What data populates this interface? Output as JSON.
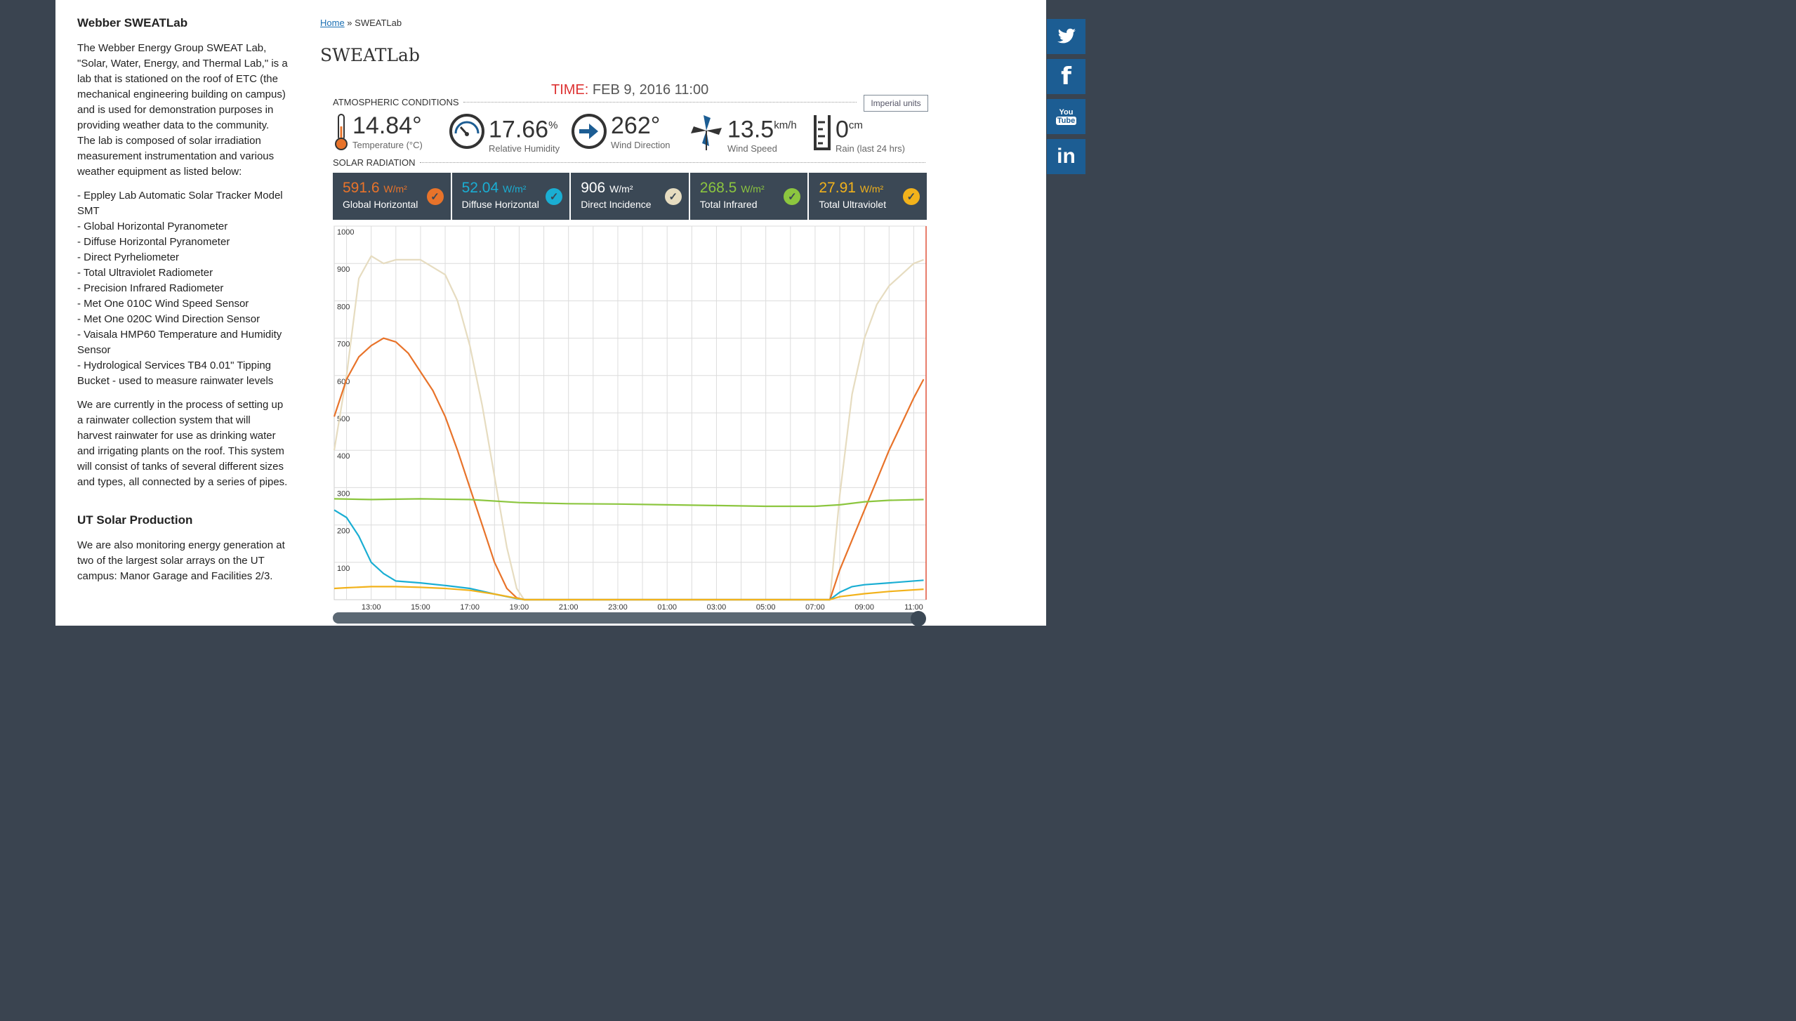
{
  "sidebar": {
    "heading": "Webber SWEATLab",
    "intro": "The Webber Energy Group SWEAT Lab, \"Solar, Water, Energy, and Thermal Lab,\" is a lab that is stationed on the roof of ETC (the mechanical engineering building on campus) and is used for demonstration purposes in providing weather data to the community. The lab is composed of solar irradiation measurement instrumentation and various weather equipment as listed below:",
    "equipment": [
      "- Eppley Lab Automatic Solar Tracker Model SMT",
      "- Global Horizontal Pyranometer",
      "- Diffuse Horizontal Pyranometer",
      "- Direct Pyrheliometer",
      "- Total Ultraviolet Radiometer",
      "- Precision Infrared Radiometer",
      "- Met One 010C Wind Speed Sensor",
      "- Met One 020C Wind Direction Sensor",
      "- Vaisala HMP60 Temperature and Humidity Sensor",
      "- Hydrological Services TB4 0.01\" Tipping Bucket - used to measure rainwater levels"
    ],
    "rainwater": "We are currently in the process of setting up a rainwater collection system that will harvest rainwater for use as drinking water and irrigating plants on the roof. This system will consist of tanks of several different sizes and types, all connected by a series of pipes.",
    "heading2": "UT Solar Production",
    "solar_text": "We are also monitoring energy generation at two of the largest solar arrays on the UT campus: Manor Garage and Facilities 2/3."
  },
  "breadcrumb": {
    "home": "Home",
    "sep": " » ",
    "current": "SWEATLab"
  },
  "page_title": "SWEATLab",
  "time": {
    "label": "TIME:",
    "value": " FEB 9, 2016 11:00"
  },
  "atmo": {
    "heading": "ATMOSPHERIC CONDITIONS",
    "units_button": "Imperial units",
    "items": [
      {
        "value": "14.84°",
        "unit": "",
        "caption": "Temperature (°C)",
        "icon": "thermometer-icon"
      },
      {
        "value": "17.66",
        "unit": "%",
        "caption": "Relative Humidity",
        "icon": "gauge-icon"
      },
      {
        "value": "262°",
        "unit": "",
        "caption": "Wind Direction",
        "icon": "arrow-circle-icon"
      },
      {
        "value": "13.5",
        "unit": "km/h",
        "caption": "Wind Speed",
        "icon": "pinwheel-icon"
      },
      {
        "value": "0",
        "unit": "cm",
        "caption": "Rain (last 24 hrs)",
        "icon": "rain-gauge-icon"
      }
    ]
  },
  "solar": {
    "heading": "SOLAR RADIATION",
    "unit": "W/m²",
    "items": [
      {
        "value": "591.6",
        "label": "Global Horizontal",
        "color": "#e8732a"
      },
      {
        "value": "52.04",
        "label": "Diffuse Horizontal",
        "color": "#1aaed3"
      },
      {
        "value": "906",
        "label": "Direct Incidence",
        "color": "#e6dcc0"
      },
      {
        "value": "268.5",
        "label": "Total Infrared",
        "color": "#8cc63f"
      },
      {
        "value": "27.91",
        "label": "Total Ultraviolet",
        "color": "#f2b21b"
      }
    ]
  },
  "chart_data": {
    "type": "line",
    "ylim": [
      0,
      1000
    ],
    "yticks": [
      100,
      200,
      300,
      "400",
      500,
      600,
      700,
      800,
      900,
      1000
    ],
    "ytick_labels": [
      "100",
      "200",
      "300",
      "400",
      "500",
      "600",
      "700",
      "800",
      "900",
      "1000"
    ],
    "xtick_labels": [
      "13:00",
      "15:00",
      "17:00",
      "19:00",
      "21:00",
      "23:00",
      "01:00",
      "03:00",
      "05:00",
      "07:00",
      "09:00",
      "11:00"
    ],
    "xlim_hours": [
      11.5,
      35.5
    ],
    "grid": true,
    "series": [
      {
        "name": "Direct Incidence",
        "color": "#e6dcc0",
        "x": [
          11.5,
          12.0,
          12.5,
          13.0,
          13.5,
          14.0,
          15.0,
          16.0,
          16.5,
          17.0,
          17.5,
          18.0,
          18.5,
          18.9,
          19.2,
          31.6,
          32.0,
          32.5,
          33.0,
          33.5,
          34.0,
          34.5,
          35.0,
          35.4
        ],
        "y": [
          400,
          600,
          860,
          920,
          900,
          910,
          910,
          870,
          800,
          680,
          520,
          330,
          140,
          30,
          0,
          0,
          280,
          550,
          700,
          790,
          840,
          870,
          900,
          910
        ]
      },
      {
        "name": "Global Horizontal",
        "color": "#e8732a",
        "x": [
          11.5,
          12.0,
          12.5,
          13.0,
          13.5,
          14.0,
          14.5,
          15.0,
          15.5,
          16.0,
          16.5,
          17.0,
          17.5,
          18.0,
          18.5,
          18.9,
          19.2,
          31.6,
          32.0,
          32.5,
          33.0,
          33.5,
          34.0,
          34.5,
          35.0,
          35.4
        ],
        "y": [
          490,
          590,
          650,
          680,
          700,
          690,
          660,
          610,
          560,
          490,
          400,
          300,
          200,
          100,
          30,
          5,
          0,
          0,
          80,
          160,
          240,
          320,
          400,
          470,
          540,
          590
        ]
      },
      {
        "name": "Total Infrared",
        "color": "#8cc63f",
        "x": [
          11.5,
          13.0,
          15.0,
          17.0,
          19.0,
          21.0,
          23.0,
          25.0,
          27.0,
          29.0,
          31.0,
          32.0,
          33.0,
          34.0,
          35.4
        ],
        "y": [
          270,
          268,
          270,
          268,
          260,
          257,
          256,
          254,
          252,
          250,
          250,
          254,
          262,
          266,
          268
        ]
      },
      {
        "name": "Diffuse Horizontal",
        "color": "#1aaed3",
        "x": [
          11.5,
          12.0,
          12.5,
          13.0,
          13.5,
          14.0,
          15.0,
          16.0,
          17.0,
          18.0,
          18.9,
          19.2,
          31.6,
          32.0,
          32.5,
          33.0,
          34.0,
          35.4
        ],
        "y": [
          240,
          220,
          170,
          100,
          70,
          50,
          45,
          38,
          30,
          15,
          3,
          0,
          0,
          20,
          35,
          40,
          45,
          52
        ]
      },
      {
        "name": "Total Ultraviolet",
        "color": "#f2b21b",
        "x": [
          11.5,
          12.0,
          13.0,
          14.0,
          15.0,
          16.0,
          17.0,
          18.0,
          18.9,
          19.2,
          31.6,
          32.0,
          33.0,
          34.0,
          35.4
        ],
        "y": [
          30,
          32,
          35,
          35,
          33,
          30,
          25,
          15,
          4,
          0,
          0,
          8,
          16,
          22,
          28
        ]
      }
    ]
  },
  "social": {
    "items": [
      {
        "icon": "twitter-icon",
        "glyph": "🐦"
      },
      {
        "icon": "facebook-icon",
        "glyph": "f"
      },
      {
        "icon": "youtube-icon",
        "glyph": "You Tube"
      },
      {
        "icon": "linkedin-icon",
        "glyph": "in"
      }
    ]
  }
}
